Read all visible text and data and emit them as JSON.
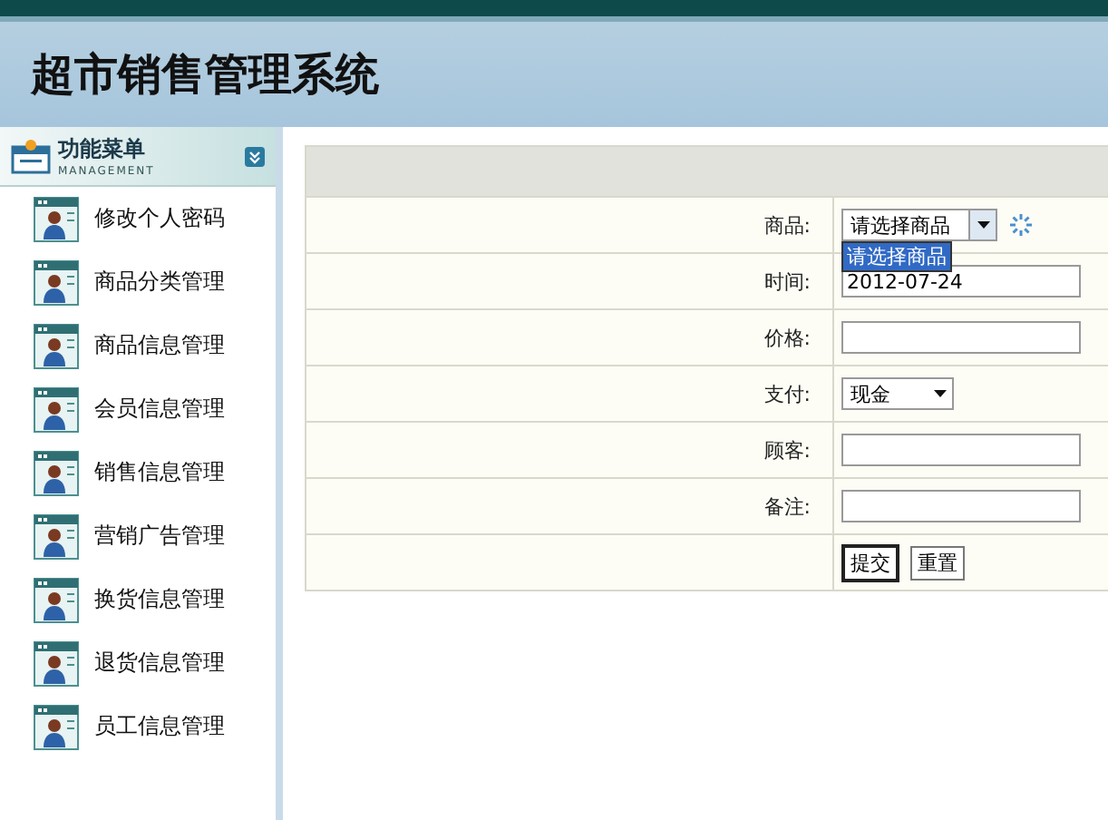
{
  "header": {
    "title": "超市销售管理系统"
  },
  "sidebar": {
    "title": "功能菜单",
    "subtitle": "MANAGEMENT",
    "items": [
      {
        "label": "修改个人密码"
      },
      {
        "label": "商品分类管理"
      },
      {
        "label": "商品信息管理"
      },
      {
        "label": "会员信息管理"
      },
      {
        "label": "销售信息管理"
      },
      {
        "label": "营销广告管理"
      },
      {
        "label": "换货信息管理"
      },
      {
        "label": "退货信息管理"
      },
      {
        "label": "员工信息管理"
      }
    ]
  },
  "form": {
    "rows": [
      {
        "kind": "select",
        "label": "商品:",
        "value": "请选择商品",
        "expanded": true,
        "loading": true,
        "options": [
          {
            "label": "请选择商品",
            "selected": true
          }
        ]
      },
      {
        "kind": "input",
        "label": "时间:",
        "value": "2012-07-24"
      },
      {
        "kind": "input",
        "label": "价格:",
        "value": ""
      },
      {
        "kind": "small-select",
        "label": "支付:",
        "value": "现金"
      },
      {
        "kind": "input",
        "label": "顾客:",
        "value": ""
      },
      {
        "kind": "input",
        "label": "备注:",
        "value": ""
      },
      {
        "kind": "buttons",
        "buttons": [
          {
            "label": "提交",
            "focused": true
          },
          {
            "label": "重置",
            "focused": false
          }
        ]
      }
    ]
  }
}
